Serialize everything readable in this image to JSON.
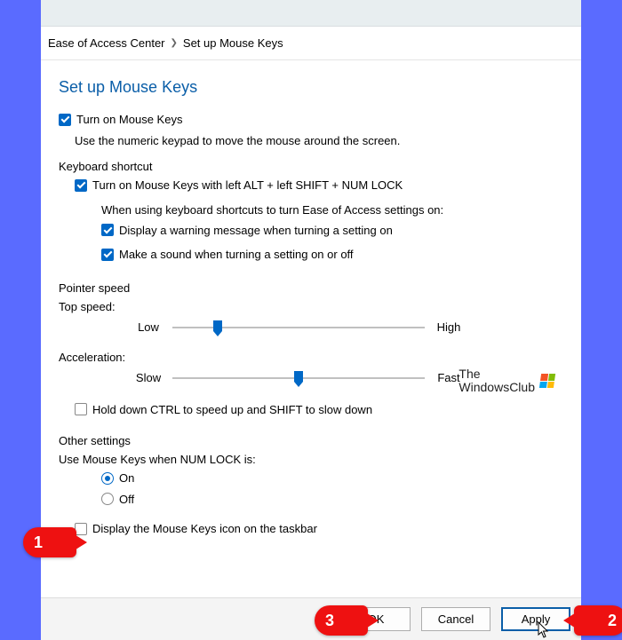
{
  "breadcrumb": {
    "parent": "Ease of Access Center",
    "current": "Set up Mouse Keys"
  },
  "page_title": "Set up Mouse Keys",
  "turn_on": {
    "label": "Turn on Mouse Keys",
    "help": "Use the numeric keypad to move the mouse around the screen."
  },
  "keyboard_shortcut": {
    "section": "Keyboard shortcut",
    "enable": "Turn on Mouse Keys with left ALT + left SHIFT + NUM LOCK",
    "when_using": "When using keyboard shortcuts to turn Ease of Access settings on:",
    "warning": "Display a warning message when turning a setting on",
    "sound": "Make a sound when turning a setting on or off"
  },
  "pointer_speed": {
    "section": "Pointer speed",
    "top_speed": "Top speed:",
    "low": "Low",
    "high": "High",
    "acceleration": "Acceleration:",
    "slow": "Slow",
    "fast": "Fast",
    "ctrl_shift": "Hold down CTRL to speed up and SHIFT to slow down"
  },
  "other": {
    "section": "Other settings",
    "numlock_label": "Use Mouse Keys when NUM LOCK is:",
    "on": "On",
    "off": "Off",
    "taskbar": "Display the Mouse Keys icon on the taskbar"
  },
  "buttons": {
    "ok": "OK",
    "cancel": "Cancel",
    "apply": "Apply"
  },
  "watermark": {
    "line1": "The",
    "line2": "WindowsClub"
  },
  "callouts": {
    "c1": "1",
    "c2": "2",
    "c3": "3"
  },
  "sliders": {
    "top_speed_pct": 18,
    "accel_pct": 50
  }
}
